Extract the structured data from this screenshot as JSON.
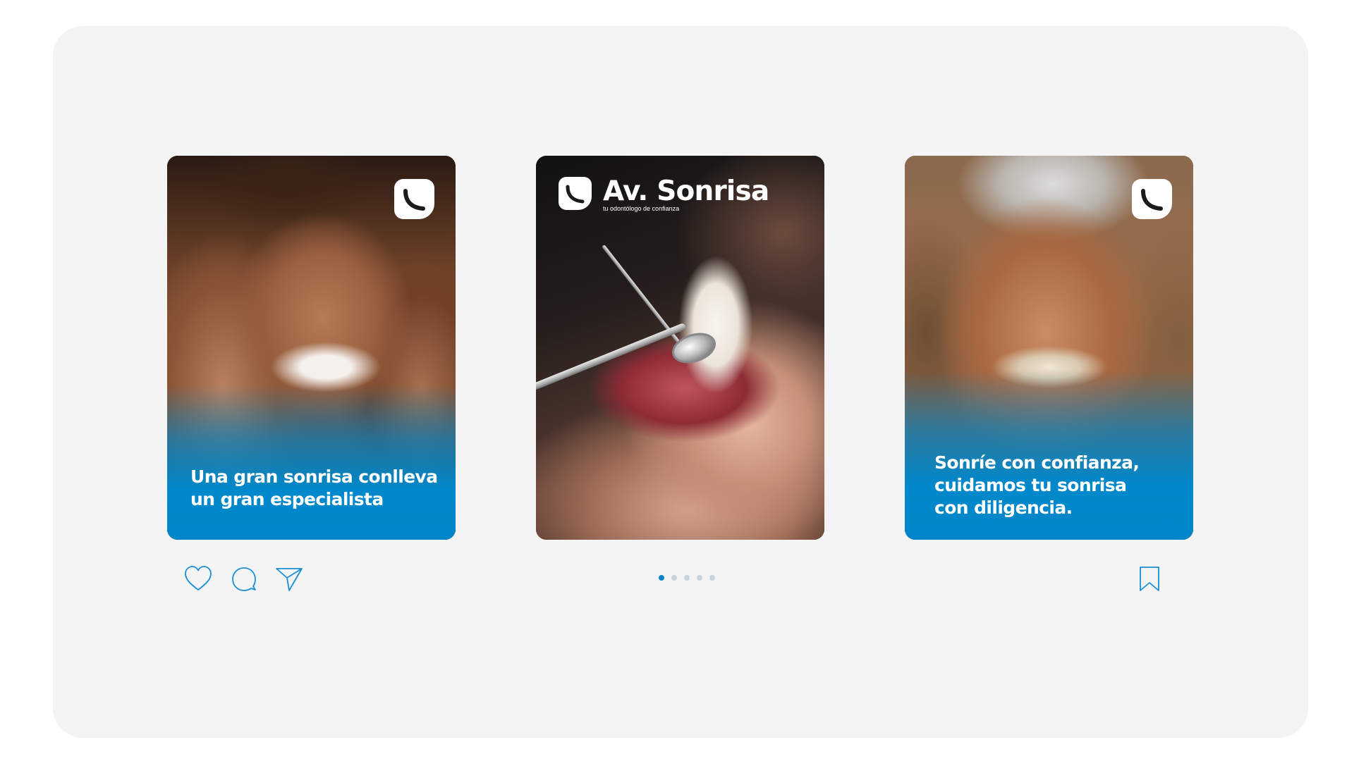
{
  "colors": {
    "accent": "#0088cc",
    "panel_background": "#f4f4f4",
    "dot_inactive": "#c9d3dc",
    "icon_stroke": "#1a8fd4"
  },
  "brand": {
    "name": "Av. Sonrisa",
    "tagline": "tu odontólogo de confianza",
    "logo_icon": "phone-handset-badge-icon"
  },
  "cards": [
    {
      "caption": "Una gran sonrisa conlleva\nun gran especialista",
      "image": "smiling-woman-photo"
    },
    {
      "caption": "",
      "image": "dental-exam-photo"
    },
    {
      "caption": "Sonríe con confianza,\ncuidamos tu sonrisa\ncon diligencia.",
      "image": "smiling-man-photo"
    }
  ],
  "actions": {
    "like_icon": "heart-icon",
    "comment_icon": "comment-icon",
    "share_icon": "send-icon",
    "save_icon": "bookmark-icon"
  },
  "carousel": {
    "total_slides": 5,
    "active_index": 0
  }
}
